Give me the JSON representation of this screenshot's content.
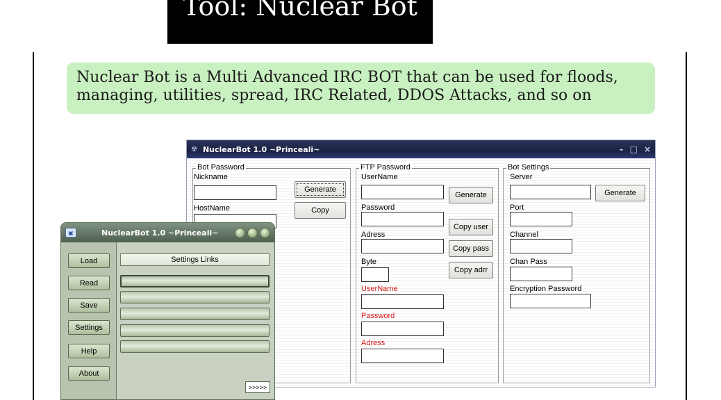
{
  "slide": {
    "title": "Tool: Nuclear Bot",
    "callout": "Nuclear Bot is a Multi Advanced IRC BOT that can be used for floods, managing, utilities, spread, IRC Related, DDOS Attacks, and so on"
  },
  "main_window": {
    "title": "NuclearBot 1.0 ~Princeali~",
    "bot_password": {
      "legend": "Bot Password",
      "nickname_label": "Nickname",
      "hostname_label": "HostName",
      "generate_label": "Generate",
      "copy_label": "Copy"
    },
    "ftp_password": {
      "legend": "FTP Password",
      "username_label": "UserName",
      "password_label": "Password",
      "adress_label": "Adress",
      "byte_label": "Byte",
      "out_username_label": "UserName",
      "out_password_label": "Password",
      "out_adress_label": "Adress",
      "generate_label": "Generate",
      "copy_user_label": "Copy user",
      "copy_pass_label": "Copy pass",
      "copy_adr_label": "Copy adrr"
    },
    "bot_settings": {
      "legend": "Bot Settings",
      "server_label": "Server",
      "port_label": "Port",
      "channel_label": "Channel",
      "chan_pass_label": "Chan Pass",
      "encryption_label": "Encryption Password",
      "generate_label": "Generate"
    }
  },
  "skin_window": {
    "title": "NuclearBot 1.0 ~Princeali~",
    "buttons": [
      "Load",
      "Read",
      "Save",
      "Settings",
      "Help",
      "About"
    ],
    "settings_links_label": "Settings Links",
    "next_label": ">>>>>"
  },
  "colors": {
    "callout_bg": "#c9f0c0",
    "title_bg": "#000000",
    "red_label": "#d81818",
    "skin_green": "#a8b49c"
  }
}
